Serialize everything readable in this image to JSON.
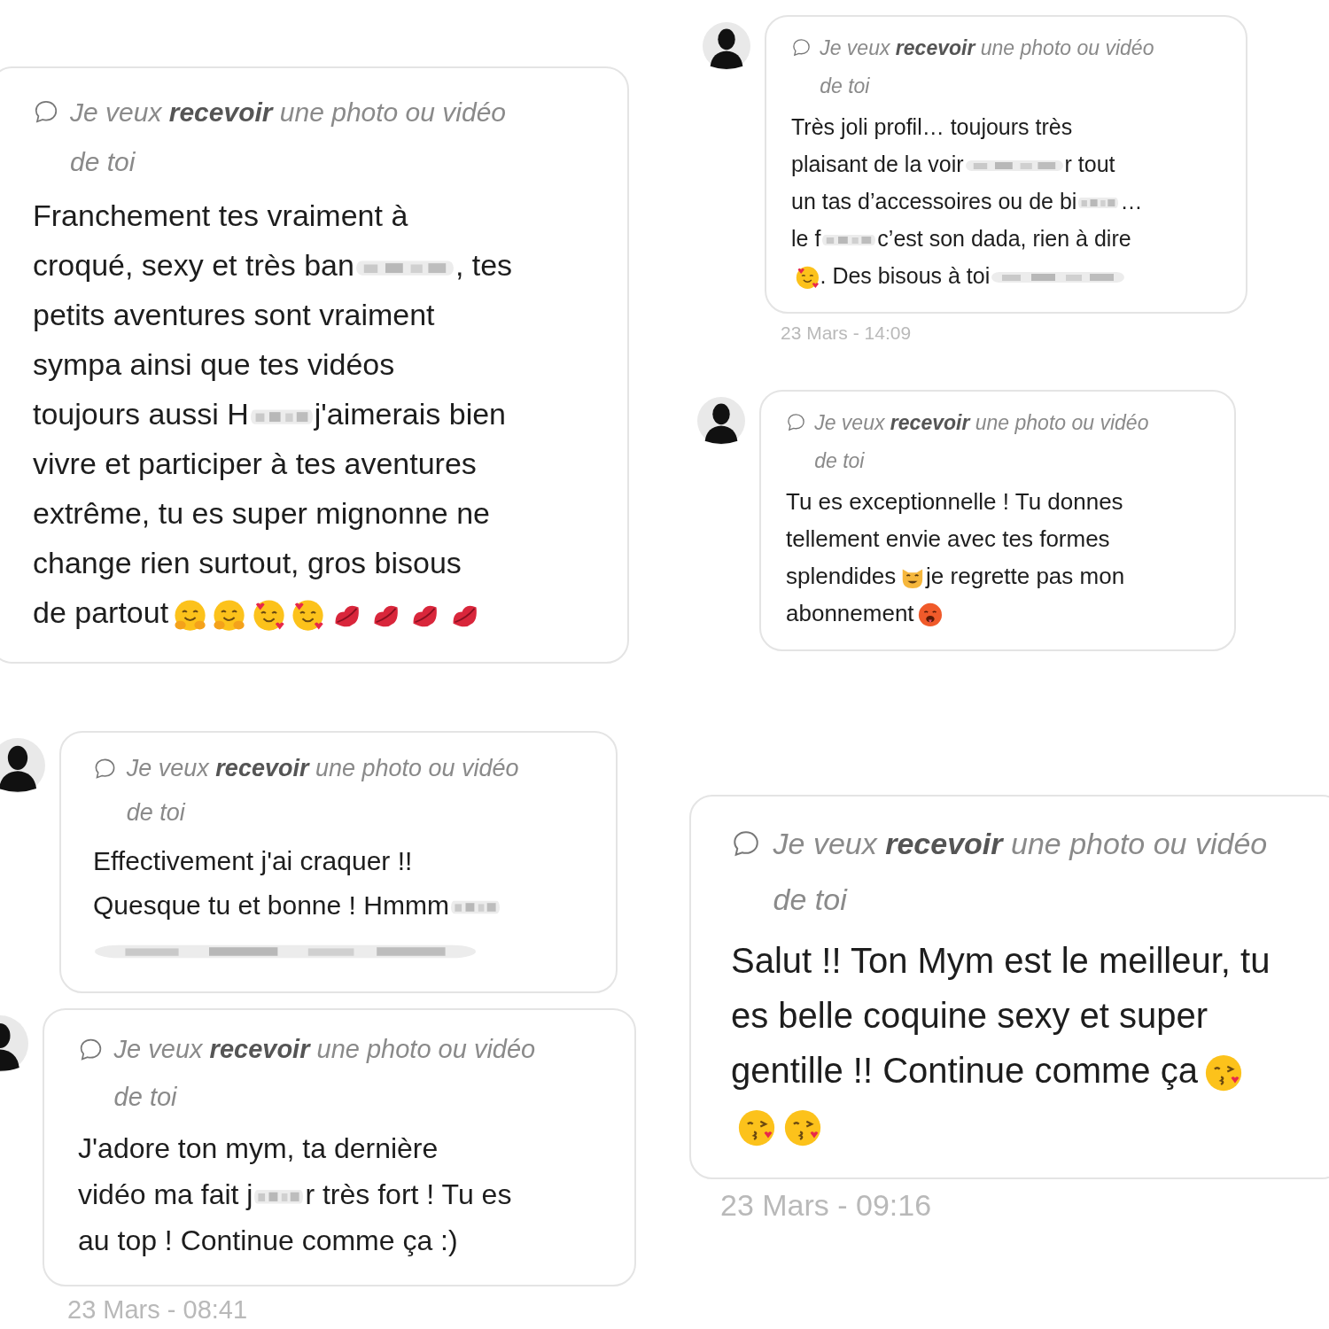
{
  "messages": [
    {
      "avatar": false,
      "prompt": "Je veux **recevoir** une photo ou vidéo de toi",
      "parts": [
        {
          "kind": "text",
          "text": "Franchement tes vraiment à"
        },
        {
          "kind": "break"
        },
        {
          "kind": "text",
          "text": "croqué, sexy et très ban"
        },
        {
          "kind": "blur"
        },
        {
          "kind": "text",
          "text": ", tes"
        },
        {
          "kind": "break"
        },
        {
          "kind": "text",
          "text": "petits aventures sont vraiment"
        },
        {
          "kind": "break"
        },
        {
          "kind": "text",
          "text": "sympa ainsi que tes vidéos"
        },
        {
          "kind": "break"
        },
        {
          "kind": "text",
          "text": "toujours aussi H"
        },
        {
          "kind": "blur"
        },
        {
          "kind": "text",
          "text": "j'aimerais bien"
        },
        {
          "kind": "break"
        },
        {
          "kind": "text",
          "text": "vivre et participer à tes aventures"
        },
        {
          "kind": "break"
        },
        {
          "kind": "text",
          "text": "extrême, tu es super mignonne ne"
        },
        {
          "kind": "break"
        },
        {
          "kind": "text",
          "text": "change rien surtout, gros bisous"
        },
        {
          "kind": "break"
        },
        {
          "kind": "text",
          "text": "de partout"
        },
        {
          "kind": "hug"
        },
        {
          "kind": "hug"
        },
        {
          "kind": "love"
        },
        {
          "kind": "love"
        },
        {
          "kind": "kiss"
        },
        {
          "kind": "kiss"
        },
        {
          "kind": "kiss"
        },
        {
          "kind": "kiss"
        }
      ]
    },
    {
      "avatar": true,
      "prompt": "Je veux **recevoir** une photo ou vidéo de toi",
      "parts": [
        {
          "kind": "text",
          "text": "Très joli profil… toujours très"
        },
        {
          "kind": "break"
        },
        {
          "kind": "text",
          "text": "plaisant de la voir"
        },
        {
          "kind": "blur"
        },
        {
          "kind": "text",
          "text": "r tout"
        },
        {
          "kind": "break"
        },
        {
          "kind": "text",
          "text": "un tas d’accessoires ou de bi"
        },
        {
          "kind": "blur"
        },
        {
          "kind": "text",
          "text": "…"
        },
        {
          "kind": "break"
        },
        {
          "kind": "text",
          "text": "le f"
        },
        {
          "kind": "blur"
        },
        {
          "kind": "text",
          "text": "c’est son dada, rien à dire"
        },
        {
          "kind": "break"
        },
        {
          "kind": "love"
        },
        {
          "kind": "text",
          "text": ". Des bisous à toi"
        },
        {
          "kind": "blur"
        }
      ],
      "time": "23 Mars - 14:09"
    },
    {
      "avatar": true,
      "prompt": "Je veux **recevoir** une photo ou vidéo de toi",
      "parts": [
        {
          "kind": "text",
          "text": "Tu es exceptionnelle ! Tu donnes"
        },
        {
          "kind": "break"
        },
        {
          "kind": "text",
          "text": "tellement envie avec tes formes"
        },
        {
          "kind": "break"
        },
        {
          "kind": "text",
          "text": "splendides"
        },
        {
          "kind": "cat"
        },
        {
          "kind": "text",
          "text": "je regrette pas mon"
        },
        {
          "kind": "break"
        },
        {
          "kind": "text",
          "text": "abonnement"
        },
        {
          "kind": "hot"
        }
      ]
    },
    {
      "avatar": true,
      "prompt": "Je veux **recevoir** une photo ou vidéo de toi",
      "parts": [
        {
          "kind": "text",
          "text": "Effectivement j'ai craquer !!"
        },
        {
          "kind": "break"
        },
        {
          "kind": "text",
          "text": "Quesque tu et bonne ! Hmmm"
        },
        {
          "kind": "blur"
        },
        {
          "kind": "break"
        },
        {
          "kind": "blur"
        }
      ]
    },
    {
      "avatar": true,
      "prompt": "Je veux **recevoir** une photo ou vidéo de toi",
      "parts": [
        {
          "kind": "text",
          "text": "J'adore ton mym, ta dernière"
        },
        {
          "kind": "break"
        },
        {
          "kind": "text",
          "text": "vidéo ma fait j"
        },
        {
          "kind": "blur"
        },
        {
          "kind": "text",
          "text": "r très fort ! Tu es"
        },
        {
          "kind": "break"
        },
        {
          "kind": "text",
          "text": "au top ! Continue comme ça :)"
        }
      ],
      "time": "23 Mars - 08:41"
    },
    {
      "avatar": false,
      "prompt": "Je veux **recevoir** une photo ou vidéo de toi",
      "parts": [
        {
          "kind": "text",
          "text": "Salut !! Ton Mym est le meilleur, tu"
        },
        {
          "kind": "break"
        },
        {
          "kind": "text",
          "text": "es belle coquine sexy et super"
        },
        {
          "kind": "break"
        },
        {
          "kind": "text",
          "text": "gentille !! Continue comme ça"
        },
        {
          "kind": "blowkiss"
        },
        {
          "kind": "break"
        },
        {
          "kind": "blowkiss"
        },
        {
          "kind": "blowkiss"
        }
      ],
      "time": "23 Mars - 09:16"
    }
  ]
}
